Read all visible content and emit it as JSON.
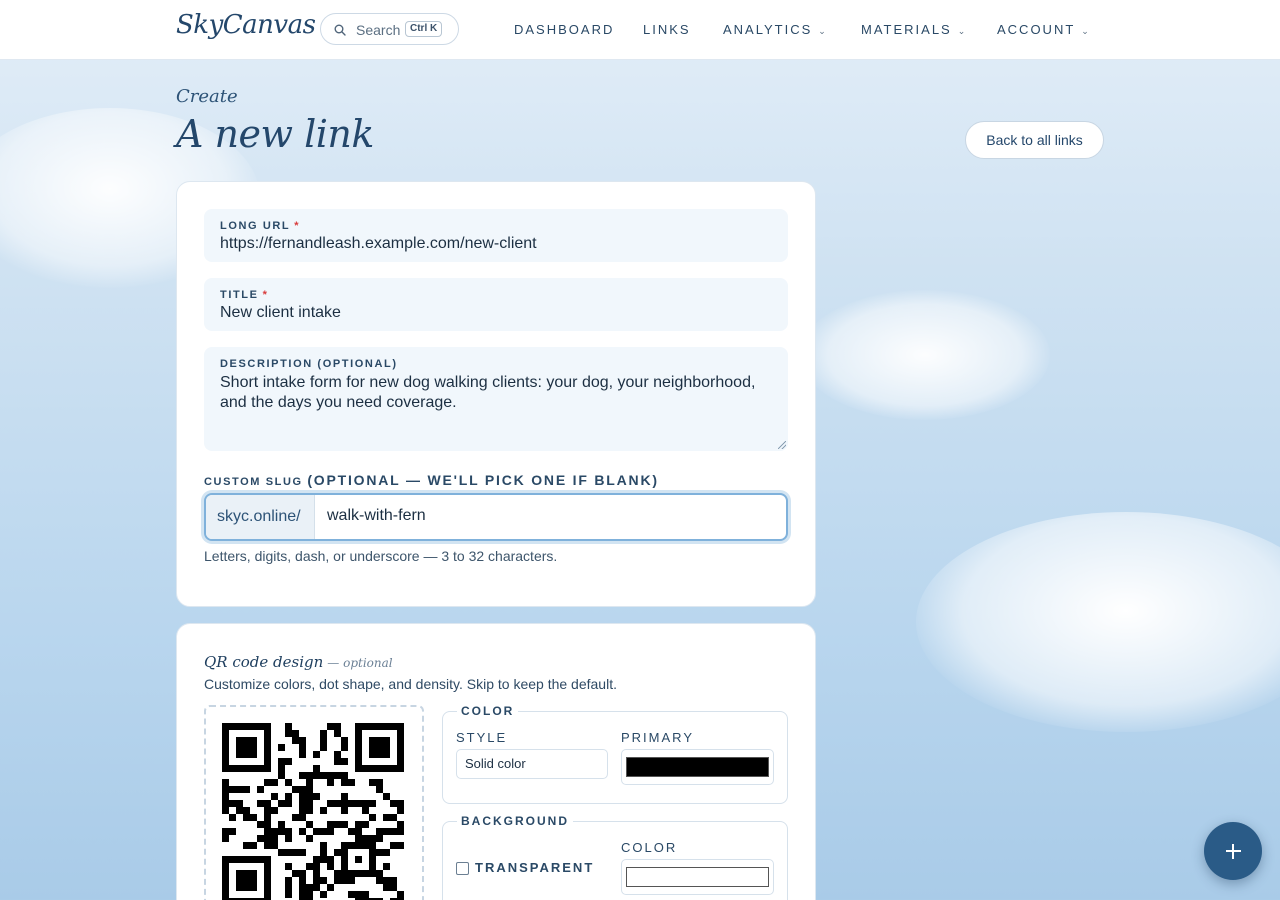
{
  "app": {
    "logo": "SkyCanvas"
  },
  "search": {
    "label": "Search",
    "shortcut": "Ctrl K"
  },
  "nav": [
    {
      "label": "Dashboard",
      "has_menu": false
    },
    {
      "label": "Links",
      "has_menu": false
    },
    {
      "label": "Analytics",
      "has_menu": true
    },
    {
      "label": "Materials",
      "has_menu": true
    },
    {
      "label": "Account",
      "has_menu": true
    }
  ],
  "header": {
    "eyebrow": "Create",
    "title": "A new link",
    "back_label": "Back to all links"
  },
  "form": {
    "long_url": {
      "label": "Long URL",
      "required_mark": "*",
      "value": "https://fernandleash.example.com/new-client"
    },
    "title": {
      "label": "Title",
      "required_mark": "*",
      "value": "New client intake"
    },
    "description": {
      "label": "Description (optional)",
      "value": "Short intake form for new dog walking clients: your dog, your neighborhood, and the days you need coverage."
    },
    "slug": {
      "label": "Custom slug",
      "label_hint": "(optional — we'll pick one if blank)",
      "prefix": "skyc.online/",
      "value": "walk-with-fern",
      "help": "Letters, digits, dash, or underscore — 3 to 32 characters."
    }
  },
  "qr": {
    "title": "QR code design",
    "title_muted": "— optional",
    "subtitle": "Customize colors, dot shape, and density. Skip to keep the default.",
    "color": {
      "legend": "Color",
      "style_label": "Style",
      "style_value": "Solid color",
      "primary_label": "Primary",
      "primary_color": "#000000"
    },
    "background": {
      "legend": "Background",
      "transparent_label": "Transparent",
      "transparent_checked": false,
      "color_label": "Color",
      "color_value": "#ffffff"
    }
  },
  "colors": {
    "accent": "#2a5b87",
    "focus_ring": "#7fb1db",
    "required": "#d83b3b"
  }
}
